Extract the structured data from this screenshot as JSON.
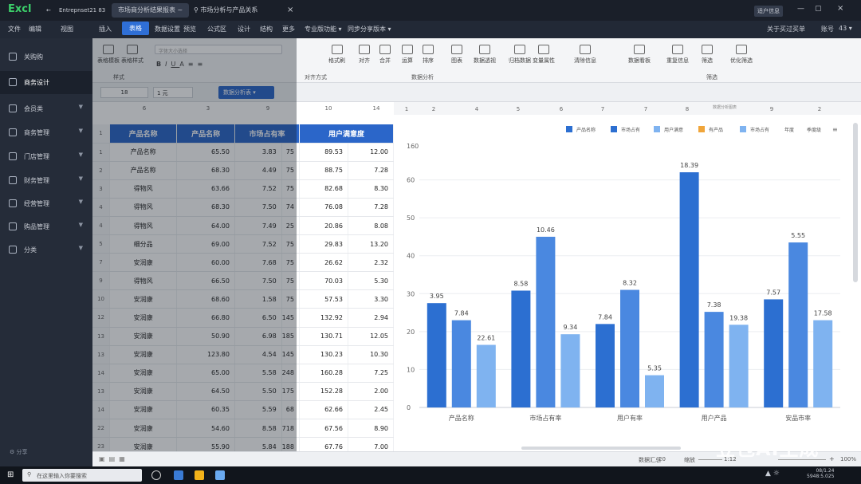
{
  "app": {
    "logo": "Excl",
    "doc_title": "Entrepnset21 83"
  },
  "titlebar": {
    "tabs": [
      "市场商分析结果报表 ~",
      "市场分析与产品关系"
    ],
    "close_label": "×",
    "user_badge": "适户信息",
    "window_controls": [
      "—",
      "▢",
      "×"
    ]
  },
  "menubar": {
    "items": [
      "文件",
      "编辑",
      "视图",
      "插入",
      "表格",
      "数据设置",
      "预览",
      "公式区",
      "设计",
      "结构",
      "更多",
      "专业版功能 ▾",
      "同步分享版本 ▾"
    ],
    "active_index": 4,
    "right": [
      "关于买过买单",
      "账号",
      "43 ▾"
    ]
  },
  "sidebar": {
    "items": [
      {
        "label": "关购购",
        "active": false,
        "has_chevron": false
      },
      {
        "label": "商务设计",
        "active": true,
        "has_chevron": false
      },
      {
        "label": "会员类",
        "active": false,
        "has_chevron": true
      },
      {
        "label": "商务管理",
        "active": false,
        "has_chevron": true
      },
      {
        "label": "门店管理",
        "active": false,
        "has_chevron": true
      },
      {
        "label": "财务管理",
        "active": false,
        "has_chevron": true
      },
      {
        "label": "经营管理",
        "active": false,
        "has_chevron": true
      },
      {
        "label": "购品管理",
        "active": false,
        "has_chevron": true
      },
      {
        "label": "分类",
        "active": false,
        "has_chevron": true
      }
    ],
    "footer": "分享"
  },
  "ribbon": {
    "buttons": [
      "表格模板",
      "表格样式",
      "格式刷",
      "对齐",
      "合并",
      "运算",
      "排序",
      "图表",
      "数据透视",
      "归档数据",
      "变量属性",
      "清除信息",
      "数据看板",
      "重复信息",
      "筛选",
      "优化筛选"
    ],
    "font_placeholder": "字体大小选择",
    "groups": [
      "样式",
      "对齐方式",
      "数据分析",
      "筛选"
    ]
  },
  "formulabar": {
    "cell_ref": "18",
    "value": "1 元",
    "dropdown": "数据分析表 ▾"
  },
  "sheet": {
    "col_headers": [
      "6",
      "3",
      "9",
      "10",
      "14"
    ],
    "headers": [
      "产品名称",
      "产品名称",
      "市场占有率",
      "用户满意度"
    ],
    "rows": [
      {
        "n": "1",
        "a": "产品名称",
        "b": "65.50",
        "c": "3.83",
        "d": "75",
        "e": "89.53",
        "f": "12.00"
      },
      {
        "n": "2",
        "a": "产品名称",
        "b": "68.30",
        "c": "4.49",
        "d": "75",
        "e": "88.75",
        "f": "7.28"
      },
      {
        "n": "3",
        "a": "得物风",
        "b": "63.66",
        "c": "7.52",
        "d": "75",
        "e": "82.68",
        "f": "8.30"
      },
      {
        "n": "4",
        "a": "得物风",
        "b": "68.30",
        "c": "7.50",
        "d": "74",
        "e": "76.08",
        "f": "7.28"
      },
      {
        "n": "4",
        "a": "得物风",
        "b": "64.00",
        "c": "7.49",
        "d": "25",
        "e": "20.86",
        "f": "8.08"
      },
      {
        "n": "5",
        "a": "细分品",
        "b": "69.00",
        "c": "7.52",
        "d": "75",
        "e": "29.83",
        "f": "13.20"
      },
      {
        "n": "7",
        "a": "安润康",
        "b": "60.00",
        "c": "7.68",
        "d": "75",
        "e": "26.62",
        "f": "2.32"
      },
      {
        "n": "9",
        "a": "得物风",
        "b": "66.50",
        "c": "7.50",
        "d": "75",
        "e": "70.03",
        "f": "5.30"
      },
      {
        "n": "10",
        "a": "安润康",
        "b": "68.60",
        "c": "1.58",
        "d": "75",
        "e": "57.53",
        "f": "3.30"
      },
      {
        "n": "12",
        "a": "安润康",
        "b": "66.80",
        "c": "6.50",
        "d": "145",
        "e": "132.92",
        "f": "2.94"
      },
      {
        "n": "13",
        "a": "安润康",
        "b": "50.90",
        "c": "6.98",
        "d": "185",
        "e": "130.71",
        "f": "12.05"
      },
      {
        "n": "13",
        "a": "安润康",
        "b": "123.80",
        "c": "4.54",
        "d": "145",
        "e": "130.23",
        "f": "10.30"
      },
      {
        "n": "14",
        "a": "安润康",
        "b": "65.00",
        "c": "5.58",
        "d": "248",
        "e": "160.28",
        "f": "7.25"
      },
      {
        "n": "13",
        "a": "安润康",
        "b": "64.50",
        "c": "5.50",
        "d": "175",
        "e": "152.28",
        "f": "2.00"
      },
      {
        "n": "14",
        "a": "安润康",
        "b": "60.35",
        "c": "5.59",
        "d": "68",
        "e": "62.66",
        "f": "2.45"
      },
      {
        "n": "22",
        "a": "安润康",
        "b": "54.60",
        "c": "8.58",
        "d": "718",
        "e": "67.56",
        "f": "8.90"
      },
      {
        "n": "23",
        "a": "安润康",
        "b": "55.90",
        "c": "5.84",
        "d": "188",
        "e": "67.76",
        "f": "7.00"
      }
    ]
  },
  "chart_header": {
    "col_numbers": [
      "1",
      "2",
      "4",
      "5",
      "6",
      "7",
      "7",
      "8",
      "9",
      "2"
    ],
    "caption": "数据分析图表"
  },
  "chart_data": {
    "type": "bar",
    "categories": [
      "产品名称",
      "市场占有率",
      "用户有率",
      "用户产品",
      "安品市率"
    ],
    "series": [
      {
        "name": "产品名称",
        "values": [
          27.5,
          30.8,
          22.0,
          62.0,
          28.5
        ],
        "color": "#2c6fd1"
      },
      {
        "name": "市场占有率",
        "values": [
          23.0,
          45.0,
          31.0,
          25.2,
          43.5
        ],
        "color": "#4a88e0"
      },
      {
        "name": "用户满意度",
        "values": [
          16.5,
          19.3,
          8.5,
          21.8,
          23.0
        ],
        "color": "#7fb3f0"
      }
    ],
    "data_labels": [
      [
        "3.95",
        "7.84",
        "22.61"
      ],
      [
        "8.58",
        "10.46",
        "9.34"
      ],
      [
        "7.84",
        "8.32",
        "5.35"
      ],
      [
        "18.39",
        "7.38",
        "19.38"
      ],
      [
        "7.57",
        "5.55",
        "17.58"
      ]
    ],
    "legend": [
      "产品名称",
      "市场占有",
      "用户满意",
      "有产品",
      "市场占有"
    ],
    "legend_colors": [
      "#2c6fd1",
      "#2c6fd1",
      "#7fb3f0",
      "#f0a53a",
      "#7fb3f0"
    ],
    "legend_extra": [
      "年度",
      "季度级"
    ],
    "ylim": [
      0,
      70
    ],
    "yticks": [
      "0",
      "10",
      "20",
      "30",
      "40",
      "50",
      "60",
      "160"
    ],
    "grid": true,
    "legend_position": "top-right"
  },
  "statusbar": {
    "left_label": "数据汇总",
    "zoom_label": "缩放",
    "page": "20",
    "page_info": "1:12",
    "zoom": "100%"
  },
  "taskbar": {
    "search_placeholder": "在这里输入你要搜索",
    "time": "08/1.24",
    "date": "5948:5.025"
  },
  "watermark": "豆包AI生成"
}
